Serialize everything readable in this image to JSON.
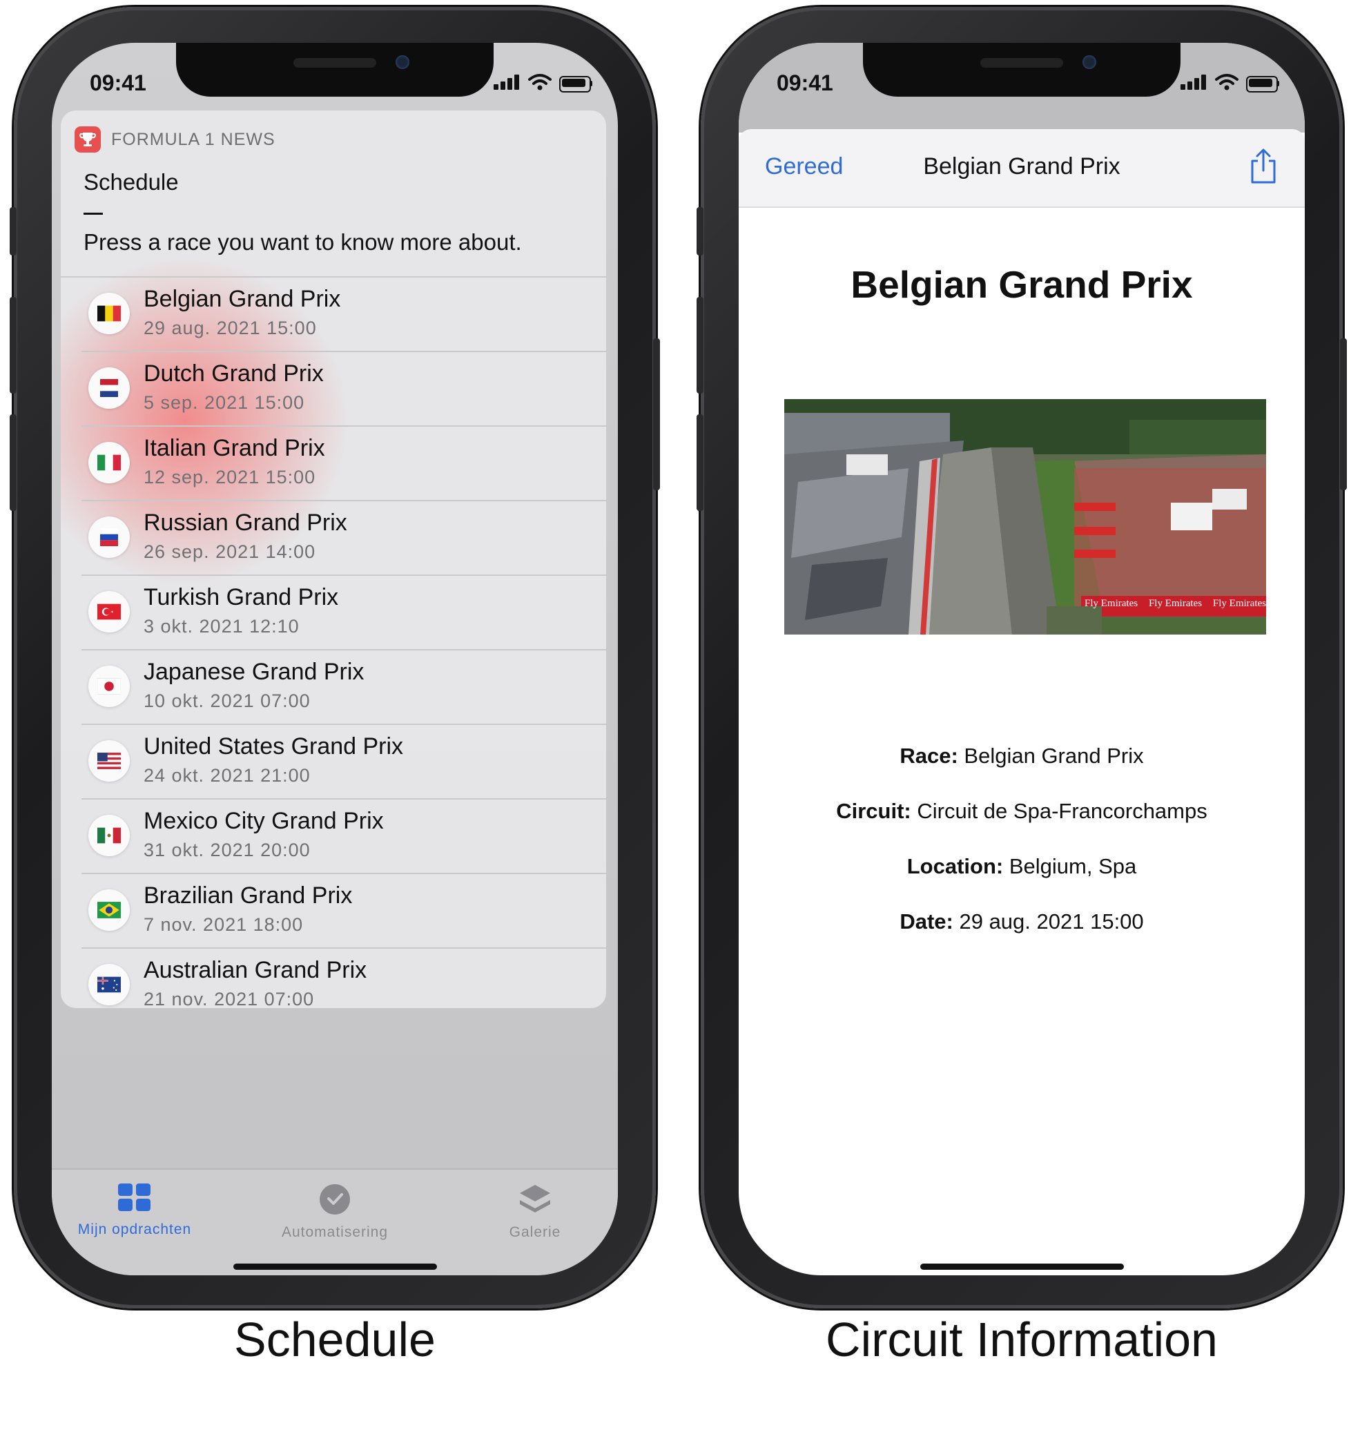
{
  "left_phone": {
    "status_time": "09:41",
    "widget": {
      "app_name": "FORMULA 1 NEWS",
      "title": "Schedule",
      "prompt": "Press a race you want to know more about.",
      "races": [
        {
          "name": "Belgian Grand Prix",
          "date": "29 aug. 2021 15:00",
          "flag": "belgium-flag-icon"
        },
        {
          "name": "Dutch Grand Prix",
          "date": "5 sep. 2021 15:00",
          "flag": "netherlands-flag-icon"
        },
        {
          "name": "Italian Grand Prix",
          "date": "12 sep. 2021 15:00",
          "flag": "italy-flag-icon"
        },
        {
          "name": "Russian Grand Prix",
          "date": "26 sep. 2021 14:00",
          "flag": "russia-flag-icon"
        },
        {
          "name": "Turkish Grand Prix",
          "date": "3 okt. 2021 12:10",
          "flag": "turkey-flag-icon"
        },
        {
          "name": "Japanese Grand Prix",
          "date": "10 okt. 2021 07:00",
          "flag": "japan-flag-icon"
        },
        {
          "name": "United States Grand Prix",
          "date": "24 okt. 2021 21:00",
          "flag": "usa-flag-icon"
        },
        {
          "name": "Mexico City Grand Prix",
          "date": "31 okt. 2021 20:00",
          "flag": "mexico-flag-icon"
        },
        {
          "name": "Brazilian Grand Prix",
          "date": "7 nov. 2021 18:00",
          "flag": "brazil-flag-icon"
        },
        {
          "name": "Australian Grand Prix",
          "date": "21 nov. 2021 07:00",
          "flag": "australia-flag-icon"
        }
      ]
    },
    "tabbar": {
      "tabs": [
        {
          "label": "Mijn opdrachten",
          "icon": "grid-icon",
          "active": true
        },
        {
          "label": "Automatisering",
          "icon": "clock-check-icon",
          "active": false
        },
        {
          "label": "Galerie",
          "icon": "layers-icon",
          "active": false
        }
      ]
    },
    "caption": "Schedule"
  },
  "right_phone": {
    "status_time": "09:41",
    "header": {
      "done_label": "Gereed",
      "title": "Belgian Grand Prix",
      "share_icon": "share-icon"
    },
    "heading": "Belgian Grand Prix",
    "details": {
      "race_label": "Race:",
      "race_value": "Belgian Grand Prix",
      "circuit_label": "Circuit:",
      "circuit_value": "Circuit de Spa-Francorchamps",
      "location_label": "Location:",
      "location_value": "Belgium, Spa",
      "date_label": "Date:",
      "date_value": "29 aug. 2021 15:00"
    },
    "photo_banners": [
      "Fly Emirates",
      "Fly Emirates",
      "Fly Emirates"
    ],
    "caption": "Circuit Information"
  },
  "colors": {
    "accent_blue": "#2f6bd6",
    "app_icon_red": "#e8504f"
  }
}
